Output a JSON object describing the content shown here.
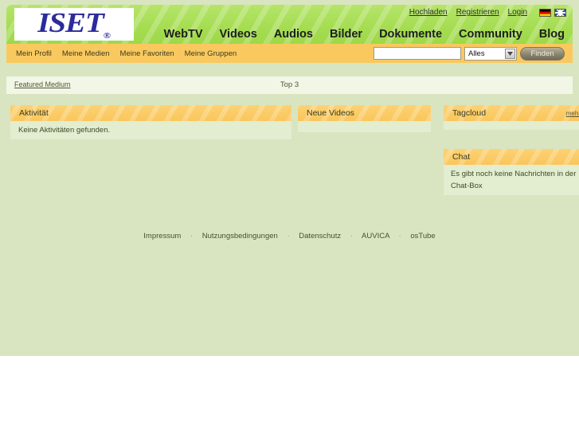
{
  "site": {
    "logo_text": "ISET",
    "logo_registered": "®"
  },
  "header": {
    "top_links": [
      {
        "label": "Hochladen",
        "name": "upload-link"
      },
      {
        "label": "Registrieren",
        "name": "register-link"
      },
      {
        "label": "Login",
        "name": "login-link"
      }
    ],
    "flags": [
      {
        "name": "flag-de-icon",
        "title": "Deutsch"
      },
      {
        "name": "flag-uk-icon",
        "title": "English"
      }
    ],
    "main_nav": [
      {
        "label": "WebTV"
      },
      {
        "label": "Videos"
      },
      {
        "label": "Audios"
      },
      {
        "label": "Bilder"
      },
      {
        "label": "Dokumente"
      },
      {
        "label": "Community"
      },
      {
        "label": "Blog"
      }
    ]
  },
  "subnav": {
    "links": [
      {
        "label": "Mein Profil"
      },
      {
        "label": "Meine Medien"
      },
      {
        "label": "Meine Favoriten"
      },
      {
        "label": "Meine Gruppen"
      }
    ],
    "search": {
      "value": "",
      "placeholder": "",
      "scope_selected": "Alles",
      "scope_options": [
        "Alles"
      ],
      "button_label": "Finden"
    }
  },
  "featured_bar": {
    "featured_label": "Featured Medium",
    "top_label": "Top 3"
  },
  "panels": {
    "aktivitaet": {
      "title": "Aktivität",
      "body": "Keine Aktivitäten gefunden."
    },
    "neue_videos": {
      "title": "Neue Videos",
      "body": ""
    },
    "tagcloud": {
      "title": "Tagcloud",
      "more_label": "mehr",
      "body": ""
    },
    "chat": {
      "title": "Chat",
      "body": "Es gibt noch keine Nachrichten in der Chat-Box"
    }
  },
  "footer": {
    "separator": "·",
    "links": [
      {
        "label": "Impressum"
      },
      {
        "label": "Nutzungsbedingungen"
      },
      {
        "label": "Datenschutz"
      },
      {
        "label": "AUVICA"
      },
      {
        "label": "osTube"
      }
    ]
  },
  "colors": {
    "page_background": "#d9e5c0",
    "header_green": "#a6dd53",
    "subnav_orange": "#f9c95f",
    "panel_header_orange": "#fbc95e",
    "panel_body_green": "#e3edd0",
    "featured_bar": "#f1f6e6",
    "logo_blue": "#2b2b9c"
  }
}
